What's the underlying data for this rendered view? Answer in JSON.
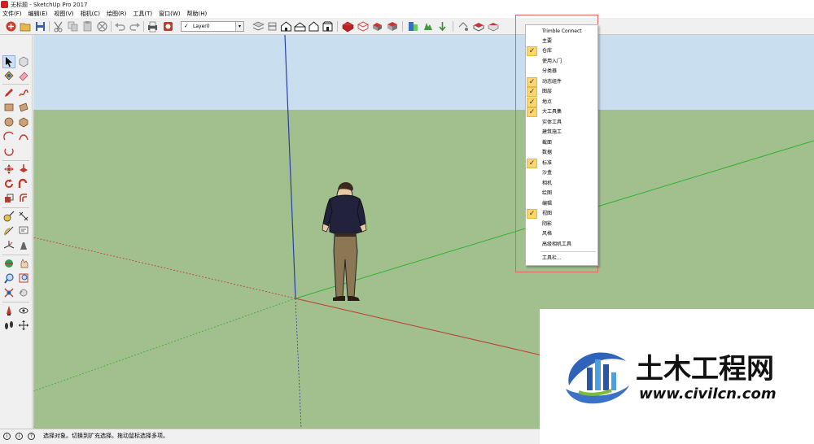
{
  "window": {
    "title": "无标题 - SketchUp Pro 2017"
  },
  "menubar": {
    "items": [
      "文件(F)",
      "编辑(E)",
      "视图(V)",
      "相机(C)",
      "绘图(R)",
      "工具(T)",
      "窗口(W)",
      "帮助(H)"
    ]
  },
  "toolbar": {
    "layer_select": {
      "checked": "✓",
      "value": "Layer0",
      "arrow": "▾"
    }
  },
  "context_menu": {
    "items": [
      {
        "label": "Trimble Connect",
        "checked": false
      },
      {
        "label": "主要",
        "checked": false
      },
      {
        "label": "仓库",
        "checked": true
      },
      {
        "label": "使用入门",
        "checked": false
      },
      {
        "label": "分类器",
        "checked": false
      },
      {
        "label": "动态组件",
        "checked": true
      },
      {
        "label": "图层",
        "checked": true
      },
      {
        "label": "地点",
        "checked": true
      },
      {
        "label": "大工具集",
        "checked": true
      },
      {
        "label": "实体工具",
        "checked": false
      },
      {
        "label": "建筑施工",
        "checked": false
      },
      {
        "label": "截面",
        "checked": false
      },
      {
        "label": "数据",
        "checked": false
      },
      {
        "label": "标准",
        "checked": true
      },
      {
        "label": "沙盒",
        "checked": false
      },
      {
        "label": "相机",
        "checked": false
      },
      {
        "label": "绘图",
        "checked": false
      },
      {
        "label": "编辑",
        "checked": false
      },
      {
        "label": "视图",
        "checked": true
      },
      {
        "label": "阴影",
        "checked": false
      },
      {
        "label": "风格",
        "checked": false
      },
      {
        "label": "高级相机工具",
        "checked": false
      },
      {
        "label": "工具栏...",
        "checked": false
      }
    ],
    "check_mark": "✓"
  },
  "statusbar": {
    "text": "选择对象。切换到扩充选择。拖动鼠标选择多项。",
    "icons": [
      "i",
      "i",
      "?"
    ]
  },
  "watermark": {
    "title": "土木工程网",
    "url": "www.civilcn.com"
  },
  "colors": {
    "sky": "#c9dff0",
    "ground": "#a2bf8e",
    "axis_red": "#c0392b",
    "axis_green": "#2db32d",
    "axis_blue": "#2b3fa8",
    "check_bg": "#fbd56f",
    "highlight_box": "#e06464"
  },
  "icons": {
    "toolbar": [
      "get-started-icon",
      "open-icon",
      "save-icon",
      "cut-icon",
      "copy-icon",
      "paste-icon",
      "erase-icon",
      "undo-icon",
      "redo-icon",
      "print-icon",
      "model-info-icon",
      "layer-manager-icon",
      "section-icon",
      "iso-view-icon",
      "top-view-icon",
      "front-view-icon",
      "right-view-icon",
      "back-view-icon",
      "left-view-icon",
      "warehouse-icon",
      "share-model-icon",
      "components-icon",
      "extension-icon",
      "dynamic-component-icon",
      "interact-icon",
      "options-icon",
      "location-icon",
      "add-location-icon",
      "terrain-icon"
    ],
    "left_toolbar": [
      "select-icon",
      "component-icon",
      "paint-bucket-icon",
      "eraser-icon",
      "pencil-icon",
      "freehand-icon",
      "rectangle-icon",
      "rotated-rectangle-icon",
      "circle-icon",
      "polygon-icon",
      "arc-icon",
      "two-point-arc-icon",
      "three-point-arc-icon",
      "pie-icon",
      "move-icon",
      "push-pull-icon",
      "rotate-icon",
      "follow-me-icon",
      "scale-icon",
      "offset-icon",
      "tape-measure-icon",
      "dimension-icon",
      "protractor-icon",
      "text-icon",
      "axes-icon",
      "3d-text-icon",
      "orbit-icon",
      "pan-icon",
      "zoom-icon",
      "zoom-window-icon",
      "zoom-extents-icon",
      "previous-icon",
      "position-camera-icon",
      "look-around-icon",
      "walk-icon",
      "section-plane-icon"
    ]
  }
}
